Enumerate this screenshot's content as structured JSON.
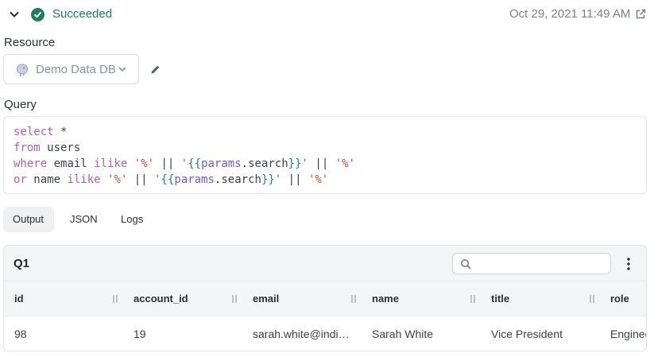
{
  "status": {
    "label": "Succeeded",
    "timestamp": "Oct 29, 2021 11:49 AM",
    "color": "#1a7f5a"
  },
  "resource": {
    "section_label": "Resource",
    "selected": "Demo Data DB",
    "icon": "postgres-elephant-icon"
  },
  "query": {
    "section_label": "Query",
    "lines": [
      [
        {
          "t": "select",
          "c": "kw"
        },
        {
          "t": " *",
          "c": ""
        }
      ],
      [
        {
          "t": "from",
          "c": "kw"
        },
        {
          "t": " users",
          "c": ""
        }
      ],
      [
        {
          "t": "where",
          "c": "kw"
        },
        {
          "t": " email ",
          "c": ""
        },
        {
          "t": "ilike",
          "c": "kw"
        },
        {
          "t": " ",
          "c": ""
        },
        {
          "t": "'%'",
          "c": "str"
        },
        {
          "t": " || ",
          "c": ""
        },
        {
          "t": "'",
          "c": "str"
        },
        {
          "t": "{{",
          "c": "tpl"
        },
        {
          "t": "params",
          "c": "param"
        },
        {
          "t": ".search",
          "c": ""
        },
        {
          "t": "}}",
          "c": "tpl"
        },
        {
          "t": "'",
          "c": "str"
        },
        {
          "t": " || ",
          "c": ""
        },
        {
          "t": "'%'",
          "c": "str"
        }
      ],
      [
        {
          "t": "or",
          "c": "kw"
        },
        {
          "t": " name ",
          "c": ""
        },
        {
          "t": "ilike",
          "c": "kw"
        },
        {
          "t": " ",
          "c": ""
        },
        {
          "t": "'%'",
          "c": "str"
        },
        {
          "t": " || ",
          "c": ""
        },
        {
          "t": "'",
          "c": "str"
        },
        {
          "t": "{{",
          "c": "tpl"
        },
        {
          "t": "params",
          "c": "param"
        },
        {
          "t": ".search",
          "c": ""
        },
        {
          "t": "}}",
          "c": "tpl"
        },
        {
          "t": "'",
          "c": "str"
        },
        {
          "t": " || ",
          "c": ""
        },
        {
          "t": "'%'",
          "c": "str"
        }
      ]
    ]
  },
  "tabs": [
    {
      "label": "Output",
      "active": true
    },
    {
      "label": "JSON",
      "active": false
    },
    {
      "label": "Logs",
      "active": false
    }
  ],
  "table": {
    "title": "Q1",
    "search_placeholder": "",
    "columns": [
      "id",
      "account_id",
      "email",
      "name",
      "title",
      "role"
    ],
    "rows": [
      [
        "98",
        "19",
        "sarah.white@indi…",
        "Sarah White",
        "Vice President",
        "Engineer"
      ]
    ]
  }
}
